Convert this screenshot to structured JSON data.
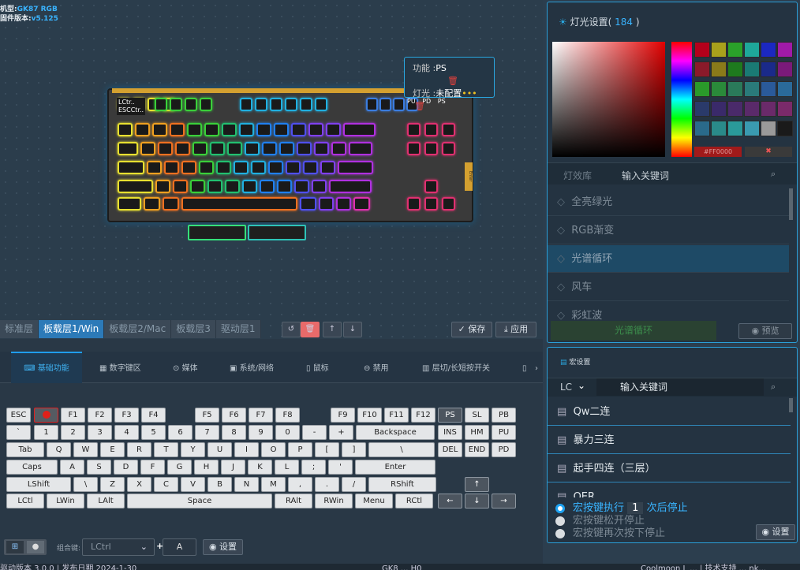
{
  "device": {
    "model_label": "机型:",
    "model_value": "GK87 RGB",
    "fw_label": "固件版本:",
    "fw_value": "v5.125"
  },
  "popup": {
    "func_label": "功能 :",
    "func_value": "PS",
    "light_label": "灯光 :",
    "light_value": "未配置"
  },
  "keyboard_caps": {
    "r1": [
      "LCtr..",
      "ESCCtr.."
    ],
    "r2": [
      "PU",
      "PD",
      "PS"
    ],
    "side_label": "Enter"
  },
  "layer_tabs": [
    "标准层",
    "板载层1/Win",
    "板载层2/Mac",
    "板载层3",
    "驱动层1"
  ],
  "layer_actions": {
    "save": "保存",
    "apply": "应用"
  },
  "func_tabs": [
    "基础功能",
    "数字键区",
    "媒体",
    "系统/网络",
    "鼠标",
    "禁用",
    "层切/长短按开关"
  ],
  "vkeys": {
    "r1": [
      "ESC",
      "",
      "F1",
      "F2",
      "F3",
      "F4",
      "F5",
      "F6",
      "F7",
      "F8",
      "F9",
      "F10",
      "F11",
      "F12",
      "PS",
      "SL",
      "PB"
    ],
    "r2": [
      "`",
      "1",
      "2",
      "3",
      "4",
      "5",
      "6",
      "7",
      "8",
      "9",
      "0",
      "-",
      "+",
      "Backspace",
      "INS",
      "HM",
      "PU"
    ],
    "r3": [
      "Tab",
      "Q",
      "W",
      "E",
      "R",
      "T",
      "Y",
      "U",
      "I",
      "O",
      "P",
      "[",
      "]",
      "\\",
      "DEL",
      "END",
      "PD"
    ],
    "r4": [
      "Caps",
      "A",
      "S",
      "D",
      "F",
      "G",
      "H",
      "J",
      "K",
      "L",
      ";",
      "'",
      "Enter"
    ],
    "r5": [
      "LShift",
      "\\",
      "Z",
      "X",
      "C",
      "V",
      "B",
      "N",
      "M",
      ",",
      ".",
      "/",
      "RShift",
      "↑"
    ],
    "r6": [
      "LCtl",
      "LWin",
      "LAlt",
      "Space",
      "RAlt",
      "RWin",
      "Menu",
      "RCtl",
      "←",
      "↓",
      "→"
    ]
  },
  "combo": {
    "label": "组合键:",
    "modifier": "LCtrl",
    "plus": "+",
    "key": "A",
    "settings": "设置"
  },
  "footer": {
    "version": "驱动版本 3.0.0 | 发布日期 2024-1-30",
    "device": "GK8 ... H0",
    "right": "Coolmoon L ... | 技术支持 ... nk..."
  },
  "lighting": {
    "title": "灯光设置(",
    "count": "184",
    "title_end": ")",
    "hex": "#FF0000",
    "lib_tab": "灯效库",
    "search_placeholder": "输入关键词",
    "effects": [
      "全亮绿光",
      "RGB渐变",
      "光谱循环",
      "风车",
      "彩虹波"
    ],
    "current_effect": "光谱循环",
    "preview": "预览",
    "swatches": [
      "#b3001b",
      "#a8a11c",
      "#2aa12a",
      "#1ea89a",
      "#1b28c1",
      "#a01aa8",
      "#8a1a2a",
      "#8a7a1a",
      "#1e7a1e",
      "#1a7a74",
      "#1a2a8a",
      "#7a1a7a",
      "#2a9a2a",
      "#2a8a3a",
      "#2a7a5a",
      "#2a7a7a",
      "#2a5a9a",
      "#2a6a9a",
      "#2a3a6a",
      "#3a2a6a",
      "#4a2a6a",
      "#5a2a6a",
      "#6a2a6a",
      "#7a2a6a",
      "#2a6a8a",
      "#2a8a8a",
      "#2a9a9a",
      "#3a9ab0",
      "#9a9a9a",
      "#1a1a1a"
    ]
  },
  "macro": {
    "title": "宏设置",
    "dropdown": "LC",
    "search_placeholder": "输入关键词",
    "items": [
      "Qw二连",
      "暴力三连",
      "起手四连（三层）",
      "QER"
    ],
    "options": [
      "宏按键执行",
      "宏按键松开停止",
      "宏按键再次按下停止"
    ],
    "count": "1",
    "count_suffix": "次后停止",
    "settings": "设置"
  }
}
